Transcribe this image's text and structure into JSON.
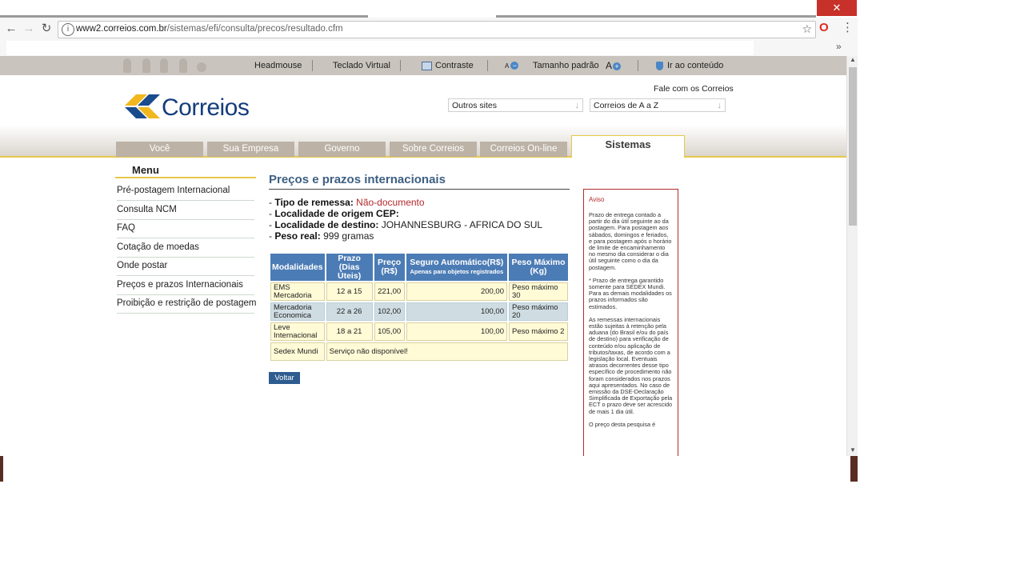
{
  "browser": {
    "url_host": "www2.correios.com.br",
    "url_path": "/sistemas/efi/consulta/precos/resultado.cfm",
    "close_glyph": "✕",
    "bookmarks_more": "»"
  },
  "accessibility_bar": {
    "headmouse": "Headmouse",
    "teclado": "Teclado Virtual",
    "contraste": "Contraste",
    "font_small": "A",
    "tamanho": "Tamanho padrão",
    "font_big": "A",
    "ir_conteudo": "Ir ao conteúdo"
  },
  "header": {
    "logo_text": "Correios",
    "fale": "Fale com os Correios",
    "outros_sites": "Outros sites",
    "correios_az": "Correios de A a Z"
  },
  "nav": {
    "tabs": [
      "Você",
      "Sua Empresa",
      "Governo",
      "Sobre Correios",
      "Correios On-line"
    ],
    "active": "Sistemas"
  },
  "menu": {
    "title": "Menu",
    "items": [
      "Pré-postagem Internacional",
      "Consulta NCM",
      "FAQ",
      "Cotação de moedas",
      "Onde postar",
      "Preços e prazos Internacionais",
      "Proibição e restrição de postagem"
    ]
  },
  "main": {
    "title": "Preços e prazos internacionais",
    "tipo_label": "Tipo de remessa:",
    "tipo_value": "Não-documento",
    "origem_label": "Localidade de origem CEP:",
    "destino_label": "Localidade de destino:",
    "destino_value": "JOHANNESBURG - AFRICA DO SUL",
    "peso_label": "Peso real:",
    "peso_value": "999 gramas",
    "table": {
      "headers": {
        "mod": "Modalidades",
        "prazo": "Prazo (Dias Úteis)",
        "preco": "Preço (R$)",
        "seguro": "Seguro Automático(R$)",
        "seguro_note": "Apenas para objetos registrados",
        "peso": "Peso Máximo (Kg)"
      },
      "rows": [
        {
          "mod": "EMS Mercadoria",
          "prazo": "12 a 15",
          "preco": "221,00",
          "seguro": "200,00",
          "peso": "Peso máximo 30"
        },
        {
          "mod": "Mercadoria Economica",
          "prazo": "22 a 26",
          "preco": "102,00",
          "seguro": "100,00",
          "peso": "Peso máximo 20"
        },
        {
          "mod": "Leve Internacional",
          "prazo": "18 a 21",
          "preco": "105,00",
          "seguro": "100,00",
          "peso": "Peso máximo 2"
        }
      ],
      "sedex": {
        "mod": "Sedex Mundi",
        "msg": "Serviço não disponível!"
      }
    },
    "voltar": "Voltar"
  },
  "aviso": {
    "title": "Aviso",
    "p1": "Prazo de entrega contado a partir do dia útil seguinte ao da postagem. Para postagem aos sábados, domingos e feriados, e para postagem após o horário de limite de encaminhamento no mesmo dia considerar o dia útil seguinte como o dia da postagem.",
    "p2": "* Prazo de entrega garantido somente para SEDEX Mundi. Para as demais modalidades os prazos informados são estimados.",
    "p3": "As remessas internacionais estão sujeitas à retenção pela aduana (do Brasil e/ou do país de destino) para verificação de conteúdo e/ou aplicação de tributos/taxas, de acordo com a legislação local. Eventuais atrasos decorrentes desse tipo específico de procedimento não foram considerados nos prazos aqui apresentados. No caso de emissão da DSE-Declaração Simplificada de Exportação pela ECT o prazo deve ser acrescido de mais 1 dia útil.",
    "p4": "O preço desta pesquisa é"
  }
}
